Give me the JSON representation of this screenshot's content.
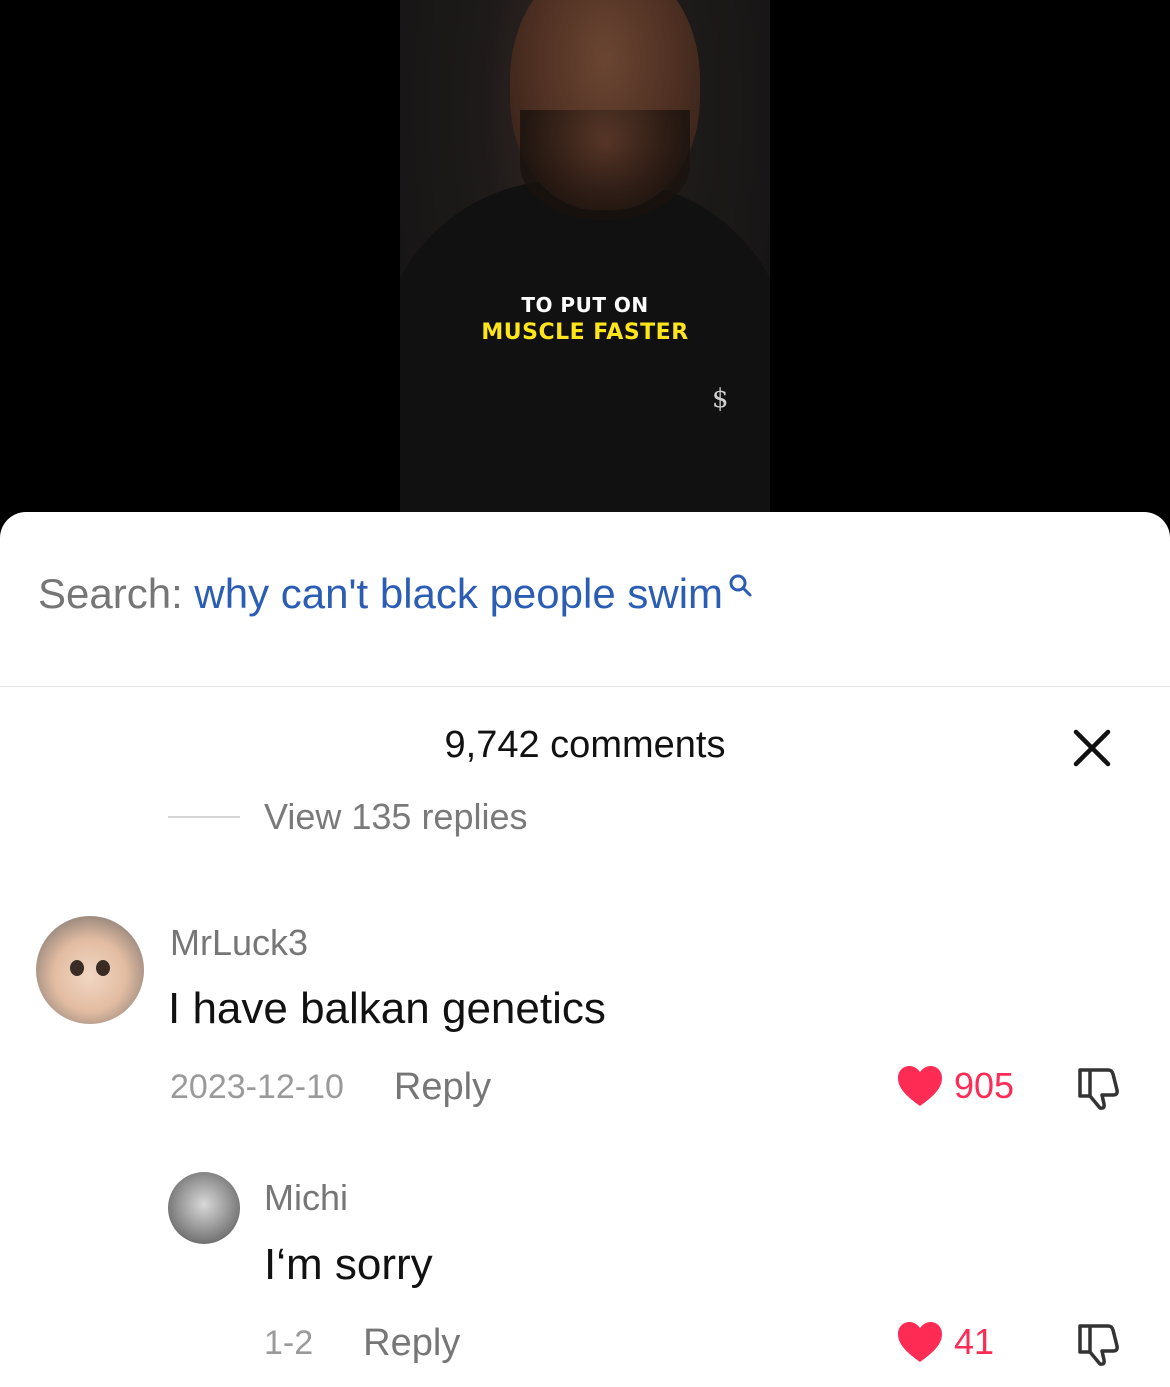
{
  "video": {
    "caption_line1": "TO PUT ON",
    "caption_line2": "MUSCLE FASTER",
    "shirt_logo": "$"
  },
  "search": {
    "prefix": "Search:",
    "query": "why can't black people swim",
    "icon": "search-icon"
  },
  "comments": {
    "count_label": "9,742 comments",
    "close_icon": "close-icon",
    "view_replies": "View 135 replies",
    "items": [
      {
        "username": "MrLuck3",
        "text": "I have balkan genetics",
        "date": "2023-12-10",
        "reply_label": "Reply",
        "likes": "905",
        "liked": true
      },
      {
        "username": "Michi",
        "text": "I‘m sorry",
        "date": "1-2",
        "reply_label": "Reply",
        "likes": "41",
        "liked": true
      }
    ]
  },
  "colors": {
    "like": "#fe2c55",
    "search_query": "#2b5db4",
    "caption_highlight": "#ffe51a"
  }
}
